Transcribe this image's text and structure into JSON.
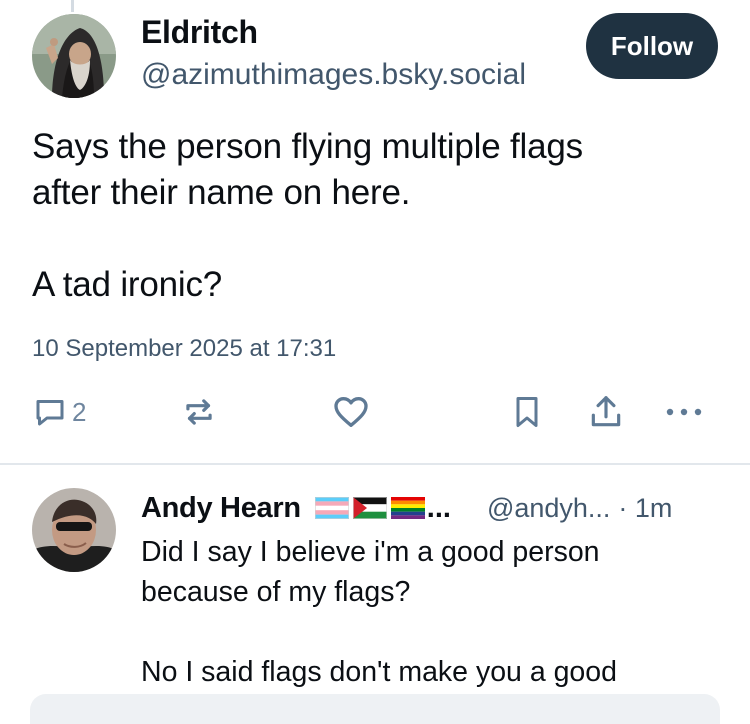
{
  "post": {
    "author_name": "Eldritch",
    "author_handle": "@azimuthimages.bsky.social",
    "follow_label": "Follow",
    "text": "Says the person flying multiple flags\nafter their name on here.\n\nA tad ironic?",
    "date": "10 September 2025 at 17:31",
    "actions": {
      "reply_count": "2",
      "icons": [
        "reply-icon",
        "repost-icon",
        "like-icon",
        "bookmark-icon",
        "share-icon",
        "more-icon"
      ]
    }
  },
  "reply": {
    "author_name": "Andy Hearn",
    "flags": [
      "transgender-flag",
      "palestine-flag",
      "pride-flag"
    ],
    "name_ellipsis": "...",
    "author_handle": "@andyh...",
    "time": "· 1m",
    "text": "Did I say I believe i'm a good person\nbecause of my flags?\n\nNo I said flags don't make you a good"
  },
  "colors": {
    "accent_button": "#1f3241",
    "muted_text": "#42576c",
    "icon_color": "#6f869f",
    "divider": "#e2e7ec"
  }
}
